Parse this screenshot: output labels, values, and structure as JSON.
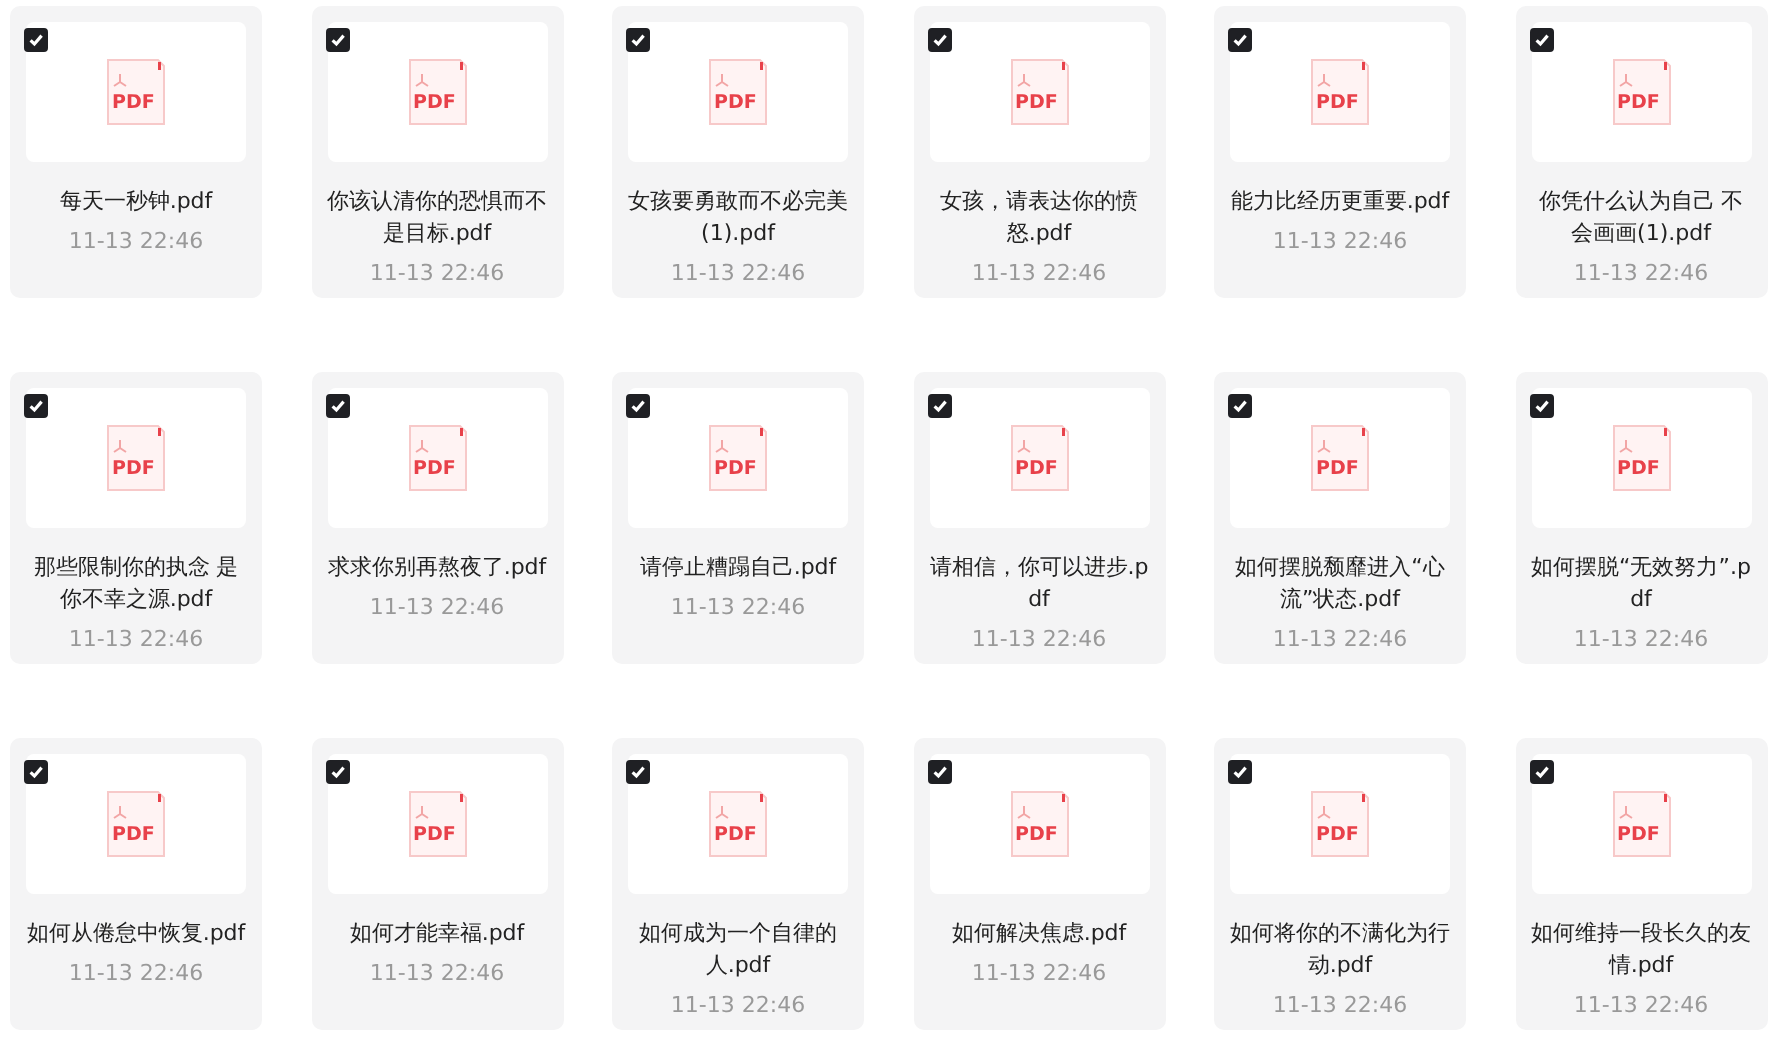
{
  "files": [
    {
      "name": "每天一秒钟.pdf",
      "date": "11-13 22:46",
      "icon_label": "PDF",
      "checked": true
    },
    {
      "name": "你该认清你的恐惧而不是目标.pdf",
      "date": "11-13 22:46",
      "icon_label": "PDF",
      "checked": true
    },
    {
      "name": "女孩要勇敢而不必完美(1).pdf",
      "date": "11-13 22:46",
      "icon_label": "PDF",
      "checked": true
    },
    {
      "name": "女孩，请表达你的愤怒.pdf",
      "date": "11-13 22:46",
      "icon_label": "PDF",
      "checked": true
    },
    {
      "name": "能力比经历更重要.pdf",
      "date": "11-13 22:46",
      "icon_label": "PDF",
      "checked": true
    },
    {
      "name": "你凭什么认为自己 不会画画(1).pdf",
      "date": "11-13 22:46",
      "icon_label": "PDF",
      "checked": true
    },
    {
      "name": "那些限制你的执念 是你不幸之源.pdf",
      "date": "11-13 22:46",
      "icon_label": "PDF",
      "checked": true
    },
    {
      "name": "求求你别再熬夜了.pdf",
      "date": "11-13 22:46",
      "icon_label": "PDF",
      "checked": true
    },
    {
      "name": "请停止糟蹋自己.pdf",
      "date": "11-13 22:46",
      "icon_label": "PDF",
      "checked": true
    },
    {
      "name": "请相信，你可以进步.pdf",
      "date": "11-13 22:46",
      "icon_label": "PDF",
      "checked": true
    },
    {
      "name": "如何摆脱颓靡进入“心流”状态.pdf",
      "date": "11-13 22:46",
      "icon_label": "PDF",
      "checked": true
    },
    {
      "name": "如何摆脱“无效努力”.pdf",
      "date": "11-13 22:46",
      "icon_label": "PDF",
      "checked": true
    },
    {
      "name": "如何从倦怠中恢复.pdf",
      "date": "11-13 22:46",
      "icon_label": "PDF",
      "checked": true
    },
    {
      "name": "如何才能幸福.pdf",
      "date": "11-13 22:46",
      "icon_label": "PDF",
      "checked": true
    },
    {
      "name": "如何成为一个自律的人.pdf",
      "date": "11-13 22:46",
      "icon_label": "PDF",
      "checked": true
    },
    {
      "name": "如何解决焦虑.pdf",
      "date": "11-13 22:46",
      "icon_label": "PDF",
      "checked": true
    },
    {
      "name": "如何将你的不满化为行动.pdf",
      "date": "11-13 22:46",
      "icon_label": "PDF",
      "checked": true
    },
    {
      "name": "如何维持一段长久的友情.pdf",
      "date": "11-13 22:46",
      "icon_label": "PDF",
      "checked": true
    }
  ]
}
